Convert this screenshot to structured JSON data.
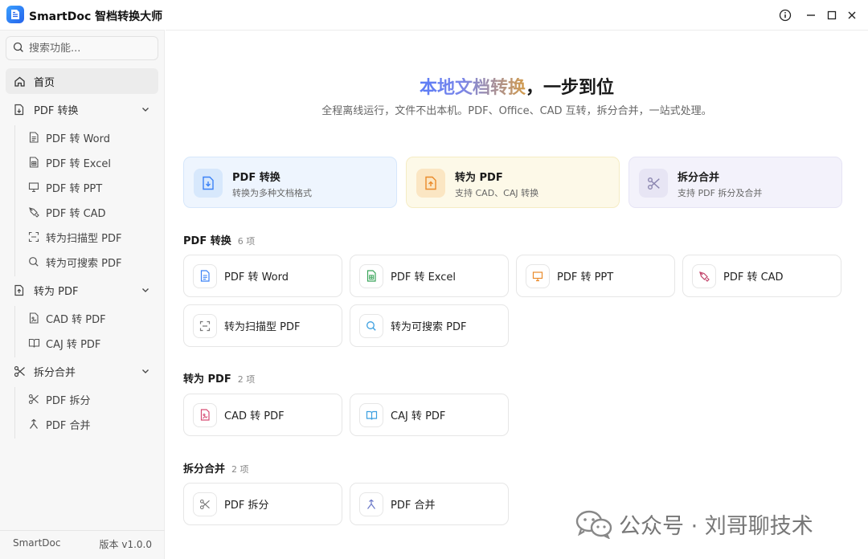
{
  "window": {
    "title": "SmartDoc 智档转换大师"
  },
  "search": {
    "placeholder": "搜索功能..."
  },
  "sidebar": {
    "home": "首页",
    "groups": [
      {
        "label": "PDF 转换",
        "items": [
          "PDF 转 Word",
          "PDF 转 Excel",
          "PDF 转 PPT",
          "PDF 转 CAD",
          "转为扫描型 PDF",
          "转为可搜索 PDF"
        ]
      },
      {
        "label": "转为 PDF",
        "items": [
          "CAD 转 PDF",
          "CAJ 转 PDF"
        ]
      },
      {
        "label": "拆分合并",
        "items": [
          "PDF 拆分",
          "PDF 合并"
        ]
      }
    ],
    "footer_left": "SmartDoc",
    "footer_right": "版本 v1.0.0"
  },
  "hero": {
    "title_highlight": "本地文档转换",
    "title_rest": "，一步到位",
    "subtitle": "全程离线运行，文件不出本机。PDF、Office、CAD 互转，拆分合并，一站式处理。"
  },
  "categories": [
    {
      "title": "PDF 转换",
      "desc": "转换为多种文档格式",
      "color": "#3b82f6"
    },
    {
      "title": "转为 PDF",
      "desc": "支持 CAD、CAJ 转换",
      "color": "#ea8a2a"
    },
    {
      "title": "拆分合并",
      "desc": "支持 PDF 拆分及合并",
      "color": "#8b86b0"
    }
  ],
  "sections": [
    {
      "title": "PDF 转换",
      "count": "6 项",
      "tools": [
        "PDF 转 Word",
        "PDF 转 Excel",
        "PDF 转 PPT",
        "PDF 转 CAD",
        "转为扫描型 PDF",
        "转为可搜索 PDF"
      ]
    },
    {
      "title": "转为 PDF",
      "count": "2 项",
      "tools": [
        "CAD 转 PDF",
        "CAJ 转 PDF"
      ]
    },
    {
      "title": "拆分合并",
      "count": "2 项",
      "tools": [
        "PDF 拆分",
        "PDF 合并"
      ]
    }
  ],
  "watermark": {
    "text": "公众号 · 刘哥聊技术"
  }
}
